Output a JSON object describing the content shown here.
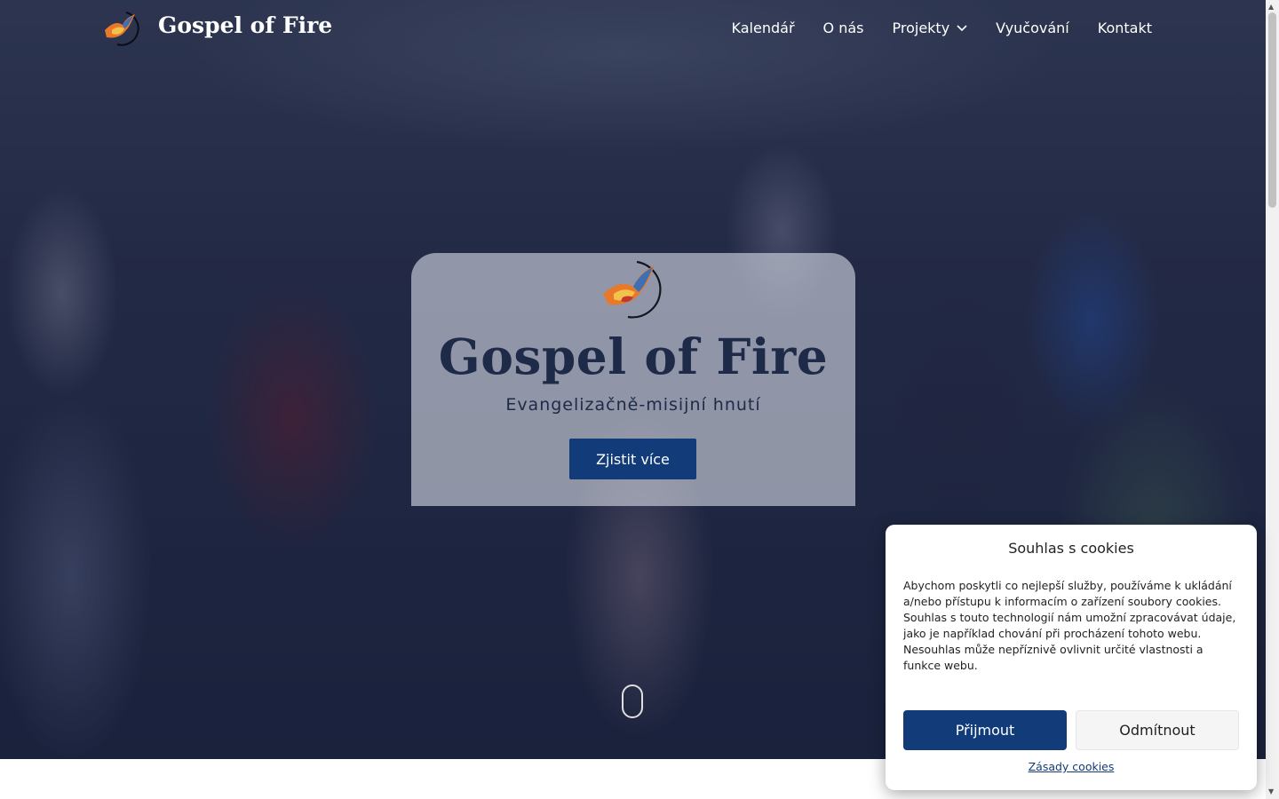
{
  "brand": {
    "name": "Gospel of Fire"
  },
  "nav": {
    "items": [
      {
        "label": "Kalendář"
      },
      {
        "label": "O nás"
      },
      {
        "label": "Projekty",
        "has_dropdown": true
      },
      {
        "label": "Vyučování"
      },
      {
        "label": "Kontakt"
      }
    ]
  },
  "hero": {
    "title": "Gospel of Fire",
    "subtitle": "Evangelizačně-misijní hnutí",
    "cta_label": "Zjistit více"
  },
  "cookie": {
    "title": "Souhlas s cookies",
    "text": "Abychom poskytli co nejlepší služby, používáme k ukládání a/nebo přístupu k informacím o zařízení soubory cookies. Souhlas s touto technologií nám umožní zpracovávat údaje, jako je například chování při procházení tohoto webu. Nesouhlas může nepříznivě ovlivnit určité vlastnosti a funkce webu.",
    "accept_label": "Přijmout",
    "deny_label": "Odmítnout",
    "policy_link": "Zásady cookies"
  },
  "colors": {
    "primary": "#123b7a",
    "title_text": "#1d2a48"
  },
  "icons": {
    "logo": "dove-fire-logo",
    "dropdown": "chevron-down-icon",
    "scroll": "mouse-scroll-icon"
  }
}
